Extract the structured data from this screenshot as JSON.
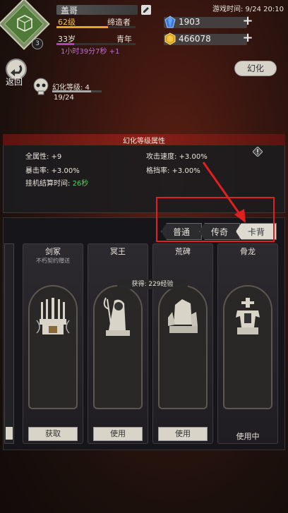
{
  "player": {
    "name": "盖哥",
    "level": "62级",
    "title": "缔造者",
    "age": "33岁",
    "stage": "青年",
    "age_timer": "1小时39分7秒 +1",
    "avatar_level": "3",
    "level_progress_pct": 65,
    "age_progress_pct": 22
  },
  "header": {
    "game_time": "游戏时间: 9/24 20:10",
    "gem_value": "1903",
    "gold_value": "466078",
    "plus": "+"
  },
  "nav": {
    "back_label": "返回",
    "illusion_button": "幻化"
  },
  "illusion": {
    "level_label": "幻化等级: 4",
    "exp": "19/24",
    "progress_pct": 79
  },
  "attributes": {
    "title": "幻化等级属性",
    "all": "全属性: +9",
    "attack_speed": "攻击速度: +3.00%",
    "crit": "暴击率: +3.00%",
    "block": "格挡率: +3.00%",
    "idle_label": "挂机结算时间: ",
    "idle_value": "26秒"
  },
  "tabs": {
    "normal": "普通",
    "legend": "传奇",
    "cardback": "卡背",
    "active": "cardback"
  },
  "cards": [
    {
      "name": "剑冢",
      "sub": "不朽契约赠送",
      "button": "获取",
      "icon": "sword-throne-icon"
    },
    {
      "name": "冥王",
      "button": "使用",
      "icon": "reaper-icon",
      "reward": "获得: 229经验"
    },
    {
      "name": "荒碑",
      "button": "使用",
      "icon": "stone-tablet-icon"
    },
    {
      "name": "骨龙",
      "status": "使用中",
      "icon": "bone-dragon-icon"
    }
  ],
  "colors": {
    "accent_red": "#e02020",
    "level_gold": "#f0c040",
    "age_purple": "#b040c0",
    "idle_green": "#50d060"
  }
}
